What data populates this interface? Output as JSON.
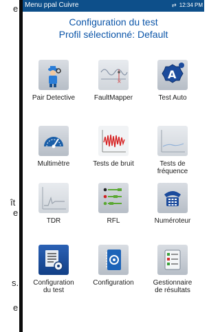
{
  "left_clip": [
    "e",
    "ît",
    "e",
    "s.",
    "e"
  ],
  "status_bar": {
    "title": "Menu ppal Cuivre",
    "time": "12:34 PM"
  },
  "header": {
    "line1": "Configuration du test",
    "line2": "Profil sélectionné:  Default"
  },
  "tiles": [
    {
      "label": "Pair Detective",
      "icon": "pair-detective-icon"
    },
    {
      "label": "FaultMapper",
      "icon": "faultmapper-icon"
    },
    {
      "label": "Test Auto",
      "icon": "auto-test-icon"
    },
    {
      "label": "Multimètre",
      "icon": "multimeter-icon"
    },
    {
      "label": "Tests de bruit",
      "icon": "noise-test-icon"
    },
    {
      "label": "Tests de fréquence",
      "icon": "frequency-test-icon"
    },
    {
      "label": "TDR",
      "icon": "tdr-icon"
    },
    {
      "label": "RFL",
      "icon": "rfl-icon"
    },
    {
      "label": "Numéroteur",
      "icon": "dialer-phone-icon"
    },
    {
      "label": "Configuration du test",
      "icon": "test-configuration-icon"
    },
    {
      "label": "Configuration",
      "icon": "configuration-icon"
    },
    {
      "label": "Gestionnaire de résultats",
      "icon": "results-manager-icon"
    }
  ],
  "colors": {
    "status_bar": "#0d4f8a",
    "heading": "#0a54a8",
    "selected_tile": "#1f4fa0"
  }
}
